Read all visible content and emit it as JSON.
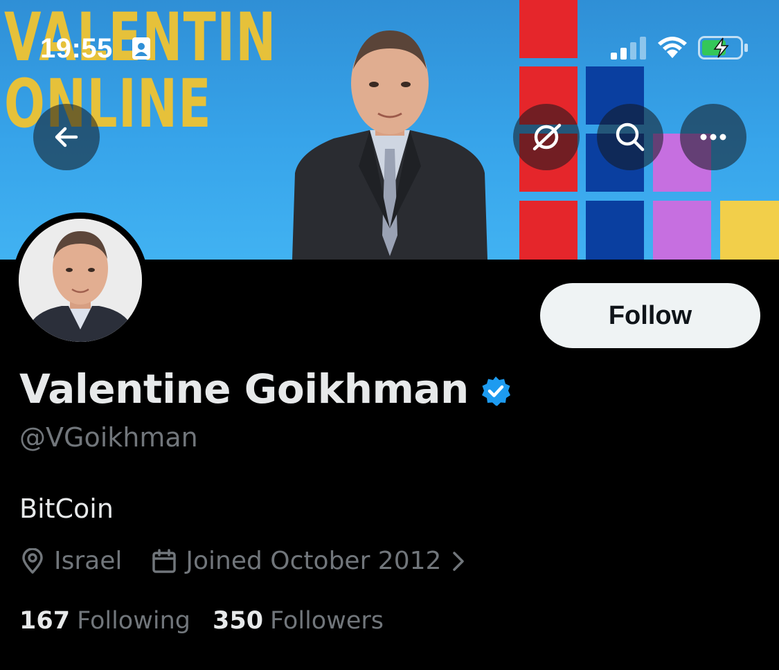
{
  "status_bar": {
    "time": "19:55",
    "contact_icon": "person-card-icon",
    "signal_icon": "cellular-signal-icon",
    "wifi_icon": "wifi-icon",
    "battery_icon": "battery-charging-icon",
    "battery_color": "#34c759"
  },
  "banner": {
    "title_line1": "VALENTIN",
    "title_line2": "ONLINE",
    "title_color": "#e6c13a",
    "background_color": "#37a4ea"
  },
  "header_actions": {
    "back_icon": "arrow-left-icon",
    "grok_icon": "grok-ai-icon",
    "search_icon": "search-icon",
    "more_icon": "more-dots-icon"
  },
  "profile": {
    "display_name": "Valentine Goikhman",
    "verified": true,
    "verified_color": "#1d9bf0",
    "handle": "@VGoikhman",
    "bio": "BitCoin",
    "location": "Israel",
    "joined": "Joined October 2012",
    "follow_label": "Follow",
    "following_count": "167",
    "following_label": "Following",
    "followers_count": "350",
    "followers_label": "Followers"
  }
}
